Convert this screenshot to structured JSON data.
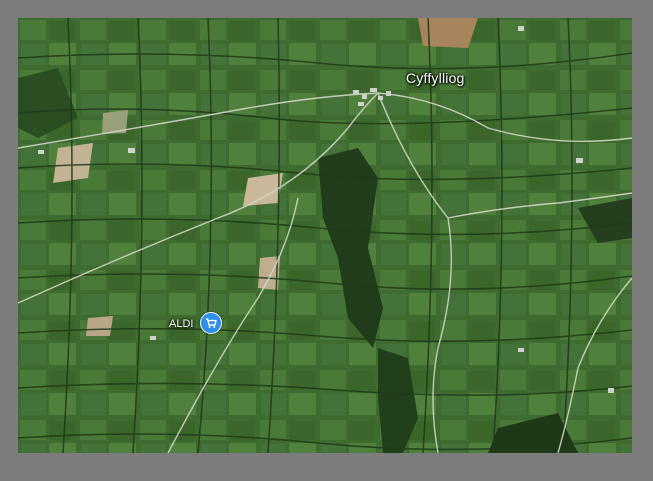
{
  "map": {
    "type": "satellite",
    "place_label": "Cyffylliog",
    "poi": {
      "label": "ALDI",
      "icon": "shopping-cart-icon",
      "pin_color": "#2f8ee5"
    },
    "colors": {
      "field_dark": "#2f5a26",
      "field_mid": "#3f6e31",
      "field_light": "#55843f",
      "hedge": "#1f3a18",
      "road": "#c9cfbf",
      "bare_field": "#b9a888",
      "frame": "#7c7c7c"
    }
  }
}
